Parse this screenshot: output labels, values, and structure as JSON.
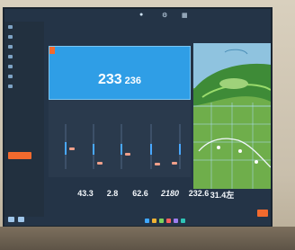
{
  "screen": {
    "speed": {
      "main": "233",
      "sub": "236"
    },
    "metric_labels": [
      "",
      "",
      "",
      "",
      ""
    ],
    "metric_values": [
      "",
      "",
      "",
      "",
      ""
    ],
    "stats": [
      "43.3",
      "2.8",
      "62.6",
      "2180",
      "232.6",
      "31.4左"
    ],
    "colors": {
      "accent": "#f26a2e",
      "speed_card": "#2f9ee6",
      "panel": "#2a3a4d",
      "bar": "#49a8ff",
      "fairway": "#6fae4b"
    }
  }
}
